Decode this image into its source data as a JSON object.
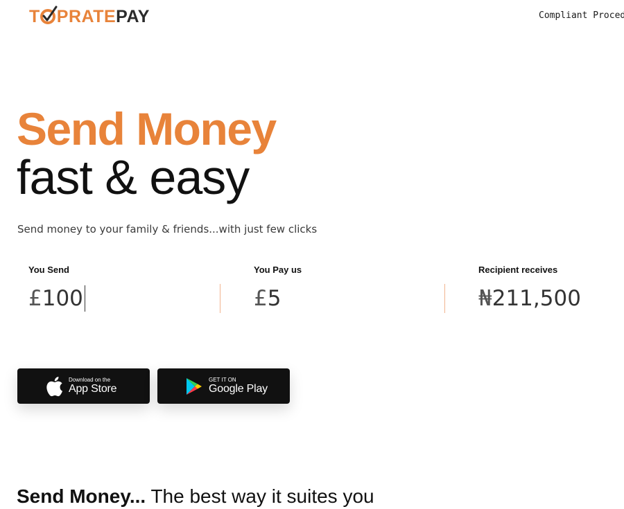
{
  "header": {
    "logo": {
      "part1": "T",
      "part2": "PRATE",
      "part3": "PAY"
    },
    "nav_link": "Compliant Proced"
  },
  "hero": {
    "title": "Send Money",
    "subtitle": "fast & easy",
    "tagline": "Send money to your family & friends...with just few clicks"
  },
  "calculator": {
    "send": {
      "label": "You Send",
      "currency": "£",
      "amount": "100"
    },
    "fee": {
      "label": "You Pay us",
      "currency": "£",
      "amount": "5"
    },
    "receive": {
      "label": "Recipient receives",
      "currency": "₦",
      "amount": "211,500"
    }
  },
  "stores": {
    "apple": {
      "small": "Download on the",
      "big": "App Store",
      "icon": "apple-icon"
    },
    "google": {
      "small": "GET IT ON",
      "big": "Google Play",
      "icon": "google-play-icon"
    }
  },
  "section": {
    "bold": "Send Money...",
    "rest": " The best way it suites you"
  },
  "colors": {
    "brand_orange": "#e8833a",
    "divider": "#f2b48e",
    "button_bg": "#111111"
  }
}
